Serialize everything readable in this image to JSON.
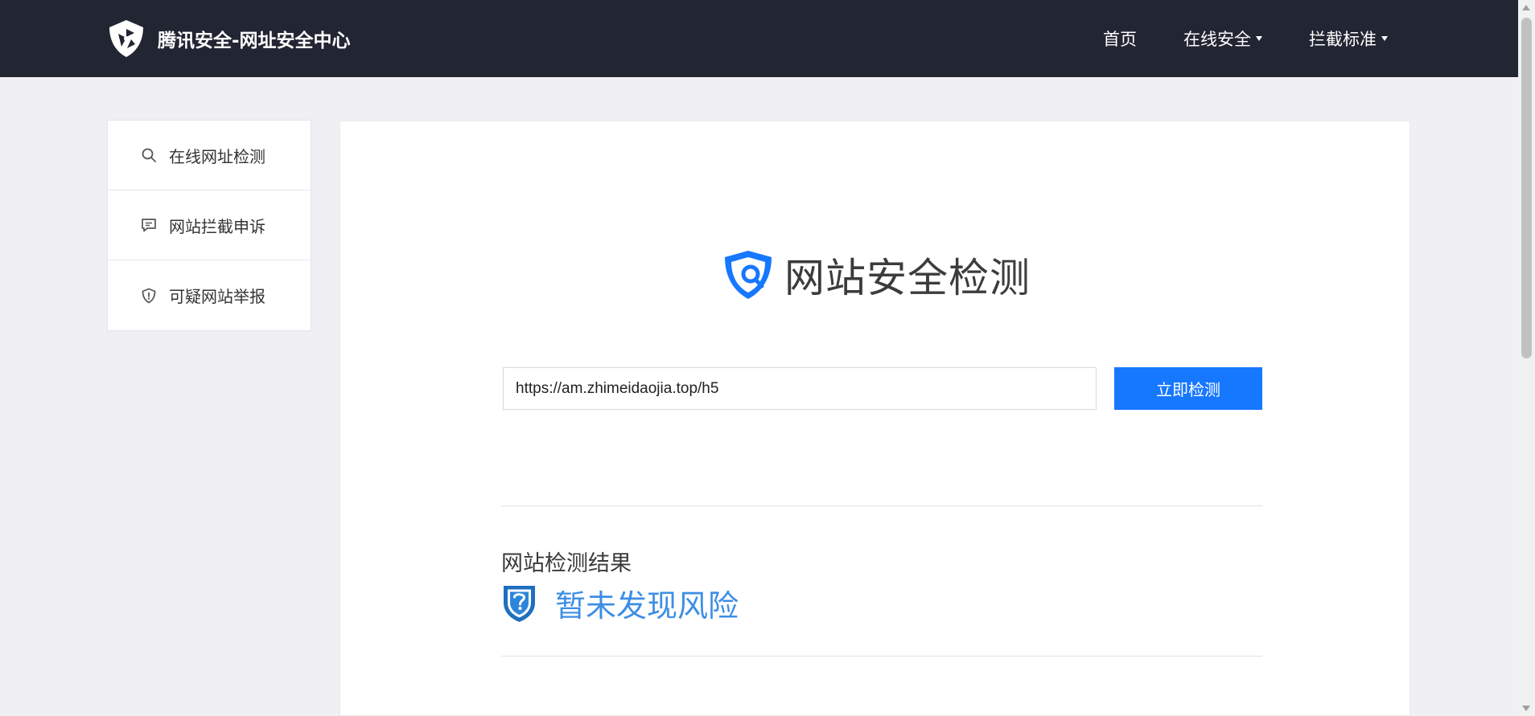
{
  "header": {
    "brand": "腾讯安全-网址安全中心",
    "nav": [
      {
        "label": "首页",
        "has_dropdown": false
      },
      {
        "label": "在线安全",
        "has_dropdown": true
      },
      {
        "label": "拦截标准",
        "has_dropdown": true
      }
    ]
  },
  "sidebar": {
    "items": [
      {
        "label": "在线网址检测",
        "icon": "search-icon"
      },
      {
        "label": "网站拦截申诉",
        "icon": "chat-bubble-icon"
      },
      {
        "label": "可疑网站举报",
        "icon": "shield-alert-icon"
      }
    ]
  },
  "main": {
    "hero_title": "网站安全检测",
    "search": {
      "value": "https://am.zhimeidaojia.top/h5",
      "button_label": "立即检测"
    },
    "result": {
      "label": "网站检测结果",
      "status": "暂未发现风险"
    }
  },
  "colors": {
    "header_bg": "#222532",
    "accent": "#1677ff",
    "result_text": "#3d8ee6",
    "page_bg": "#f0f0f4"
  }
}
